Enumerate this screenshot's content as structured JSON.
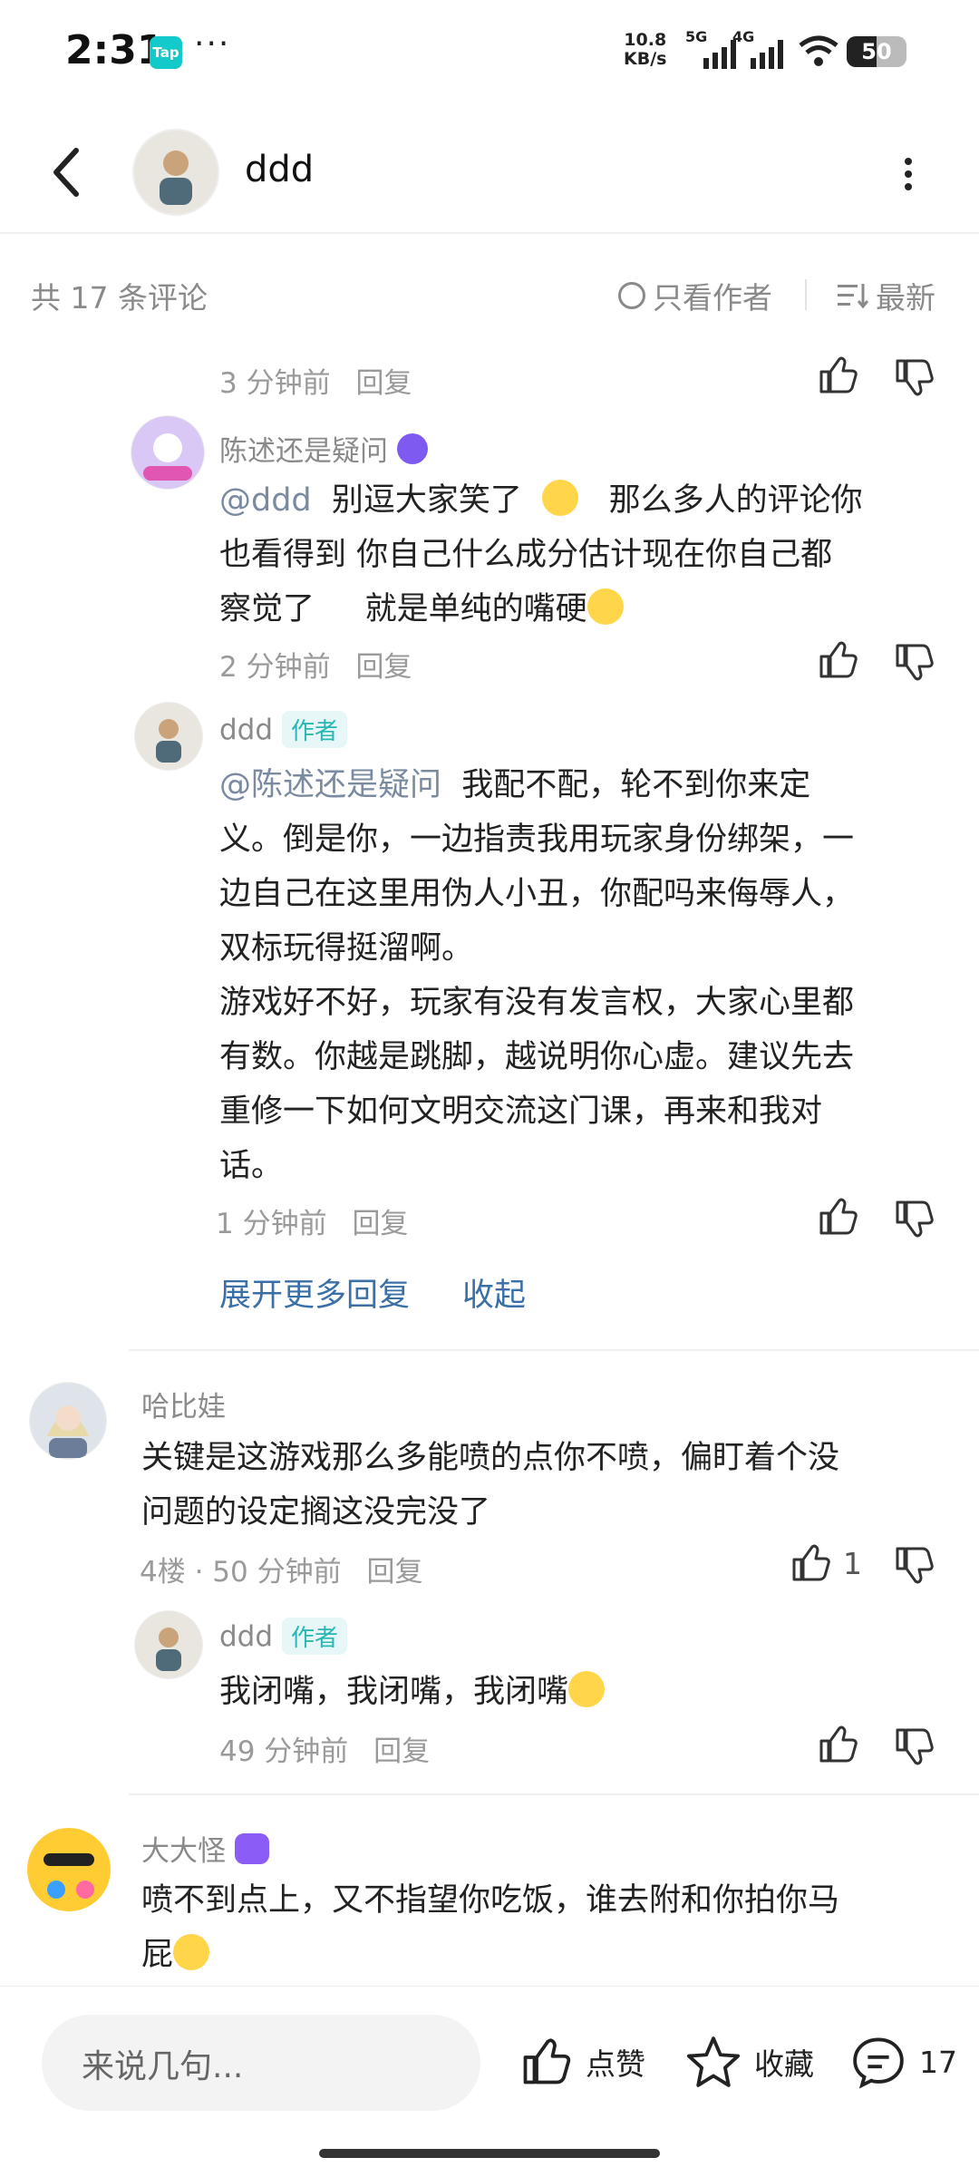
{
  "status": {
    "time": "2:31",
    "app_badge": "Tap",
    "dots": "···",
    "net_speed": "10.8\nKB/s",
    "sig1": "5G",
    "sig2": "4G",
    "battery": "50"
  },
  "header": {
    "name": "ddd"
  },
  "comments_header": {
    "count": "共 17 条评论",
    "author_only": "只看作者",
    "sort": "最新"
  },
  "top_meta": {
    "time": "3 分钟前",
    "reply": "回复"
  },
  "replies1": [
    {
      "name": "陈述还是疑问",
      "mention": "@ddd",
      "text_lines": [
        "别逗大家笑了",
        "那么多人的评论你",
        "也看得到  你自己什么成分估计现在你自己都",
        "察觉了     就是单纯的嘴硬"
      ],
      "time": "2 分钟前",
      "reply": "回复"
    },
    {
      "name": "ddd",
      "tag": "作者",
      "mention": "@陈述还是疑问",
      "text_lines": [
        "我配不配，轮不到你来定",
        "义。倒是你，一边指责我用玩家身份绑架，一",
        "边自己在这里用伪人小丑，你配吗来侮辱人，",
        "双标玩得挺溜啊。",
        "游戏好不好，玩家有没有发言权，大家心里都",
        "有数。你越是跳脚，越说明你心虚。建议先去",
        "重修一下如何文明交流这门课，再来和我对",
        "话。"
      ],
      "time": "1 分钟前",
      "reply": "回复"
    }
  ],
  "expand": {
    "more": "展开更多回复",
    "collapse": "收起"
  },
  "comment4": {
    "name": "哈比娃",
    "text_lines": [
      "关键是这游戏那么多能喷的点你不喷，偏盯着个没",
      "问题的设定搁这没完没了"
    ],
    "floor": "4楼 · 50 分钟前",
    "reply": "回复",
    "likes": "1"
  },
  "reply4": {
    "name": "ddd",
    "tag": "作者",
    "text": "我闭嘴，我闭嘴，我闭嘴",
    "time": "49 分钟前",
    "reply": "回复"
  },
  "comment5": {
    "name": "大大怪",
    "text_lines": [
      "喷不到点上，又不指望你吃饭，谁去附和你拍你马",
      "屁"
    ]
  },
  "bottom": {
    "placeholder": "来说几句...",
    "like": "点赞",
    "favorite": "收藏",
    "comments": "17"
  },
  "colors": {
    "accent": "#3a6fa8",
    "author_tag": "#27b7b7",
    "muted": "#9a9a9a"
  }
}
